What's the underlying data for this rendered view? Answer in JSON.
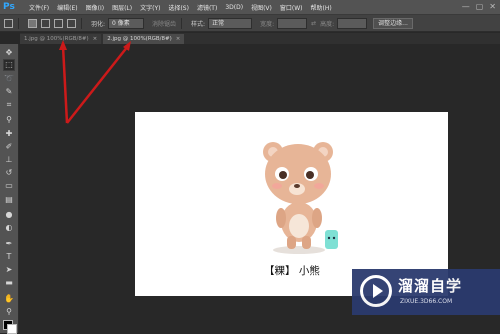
{
  "app": {
    "logo": "Ps",
    "menu": [
      "文件(F)",
      "编辑(E)",
      "图像(I)",
      "图层(L)",
      "文字(Y)",
      "选择(S)",
      "滤镜(T)",
      "3D(D)",
      "视图(V)",
      "窗口(W)",
      "帮助(H)"
    ],
    "window_controls": [
      "—",
      "▢",
      "✕"
    ]
  },
  "options": {
    "feather_label": "羽化:",
    "feather_value": "0 像素",
    "antialias_label": "消除锯齿",
    "style_label": "样式:",
    "style_value": "正常",
    "width_label": "宽度:",
    "height_label": "高度:",
    "refine_edge_button": "调整边缘..."
  },
  "tabs": [
    {
      "label": "1.jpg @ 100%(RGB/8#)",
      "close": "×",
      "active": false
    },
    {
      "label": "2.jpg @ 100%(RGB/8#)",
      "close": "×",
      "active": true
    }
  ],
  "document": {
    "caption": "【粿】 小熊"
  },
  "watermark": {
    "title": "溜溜自学",
    "url": "ZIXUE.3D66.COM"
  },
  "colors": {
    "annotation_arrow": "#cc1a1a",
    "watermark_bg": "#2b3a6e"
  },
  "tools": [
    "move-icon",
    "marquee-icon",
    "lasso-icon",
    "quick-select-icon",
    "crop-icon",
    "eyedropper-icon",
    "healing-icon",
    "brush-icon",
    "clone-stamp-icon",
    "history-brush-icon",
    "eraser-icon",
    "gradient-icon",
    "blur-icon",
    "dodge-icon",
    "pen-icon",
    "type-icon",
    "path-select-icon",
    "shape-icon",
    "hand-icon",
    "zoom-icon"
  ]
}
